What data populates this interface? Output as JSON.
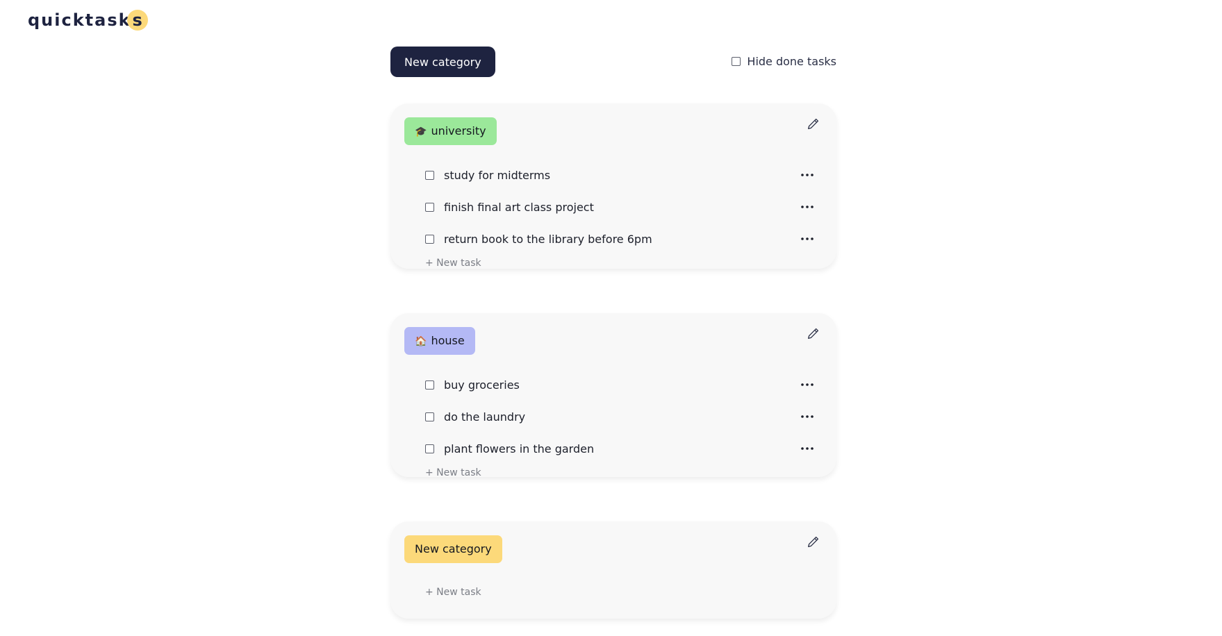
{
  "app": {
    "logo_main": "quicktask",
    "logo_accent": "s",
    "accent_color": "#fcd97a",
    "brand_color": "#1e2340"
  },
  "toolbar": {
    "new_category_label": "New category",
    "hide_done_label": "Hide done tasks",
    "hide_done_checked": false
  },
  "categories": [
    {
      "emoji": "🎓",
      "name": "university",
      "color": "#9be89a",
      "tasks": [
        {
          "text": "study for midterms",
          "done": false
        },
        {
          "text": "finish final art class project",
          "done": false
        },
        {
          "text": "return book to the library before 6pm",
          "done": false
        }
      ],
      "new_task_label": "+ New task"
    },
    {
      "emoji": "🏠",
      "name": "house",
      "color": "#b4b9f5",
      "tasks": [
        {
          "text": "buy groceries",
          "done": false
        },
        {
          "text": "do the laundry",
          "done": false
        },
        {
          "text": "plant flowers in the garden",
          "done": false
        }
      ],
      "new_task_label": "+ New task"
    },
    {
      "emoji": "",
      "name": "New category",
      "color": "#fcd97a",
      "tasks": [],
      "new_task_label": "+ New task"
    }
  ],
  "icons": {
    "edit": "pencil-icon",
    "task_menu": "more-horizontal-icon",
    "checkbox": "checkbox-icon"
  }
}
